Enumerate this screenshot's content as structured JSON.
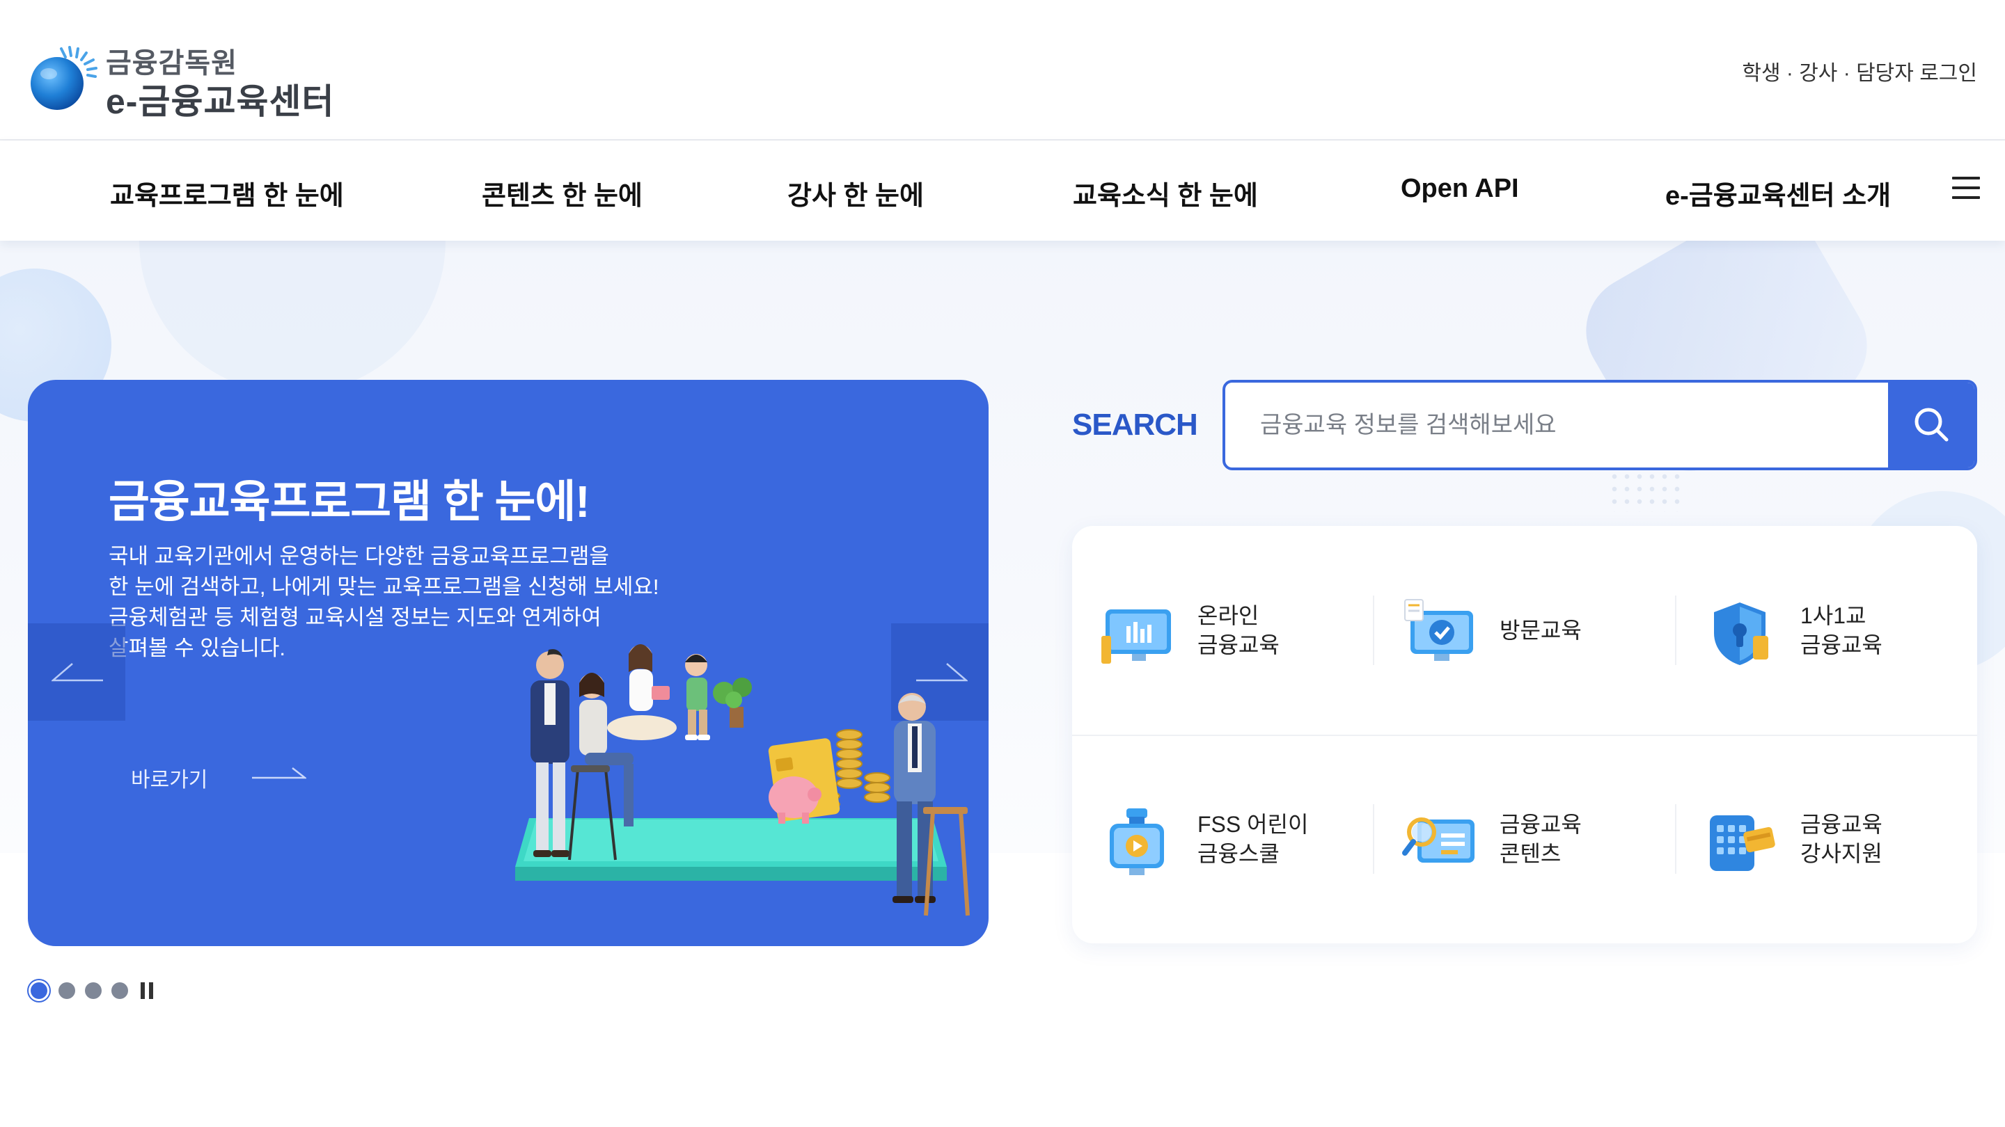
{
  "header": {
    "logo_line1": "금융감독원",
    "logo_line2": "e-금융교육센터",
    "login_link": "학생 · 강사 · 담당자 로그인"
  },
  "nav": {
    "items": [
      "교육프로그램 한 눈에",
      "콘텐츠 한 눈에",
      "강사 한 눈에",
      "교육소식 한 눈에",
      "Open API",
      "e-금융교육센터 소개"
    ],
    "menu_icon": "hamburger-menu-icon"
  },
  "banner": {
    "title": "금융교육프로그램 한 눈에!",
    "description": [
      "국내 교육기관에서 운영하는 다양한 금융교육프로그램을",
      "한 눈에 검색하고, 나에게 맞는 교육프로그램을 신청해 보세요!",
      "금융체험관 등 체험형 교육시설 정보는 지도와 연계하여",
      "살펴볼 수 있습니다."
    ],
    "link_label": "바로가기",
    "prev_icon": "arrow-left-icon",
    "next_icon": "arrow-right-icon",
    "background_color": "#3a68de",
    "slide_count": 4,
    "active_slide": 1
  },
  "search": {
    "label": "SEARCH",
    "placeholder": "금융교육 정보를 검색해보세요",
    "value": "",
    "button_icon": "search-icon",
    "accent_color": "#3a68de"
  },
  "quick_menu": {
    "items": [
      {
        "line1": "온라인",
        "line2": "금융교육",
        "icon": "monitor-chart-icon"
      },
      {
        "line1": "방문교육",
        "line2": "",
        "icon": "monitor-check-icon"
      },
      {
        "line1": "1사1교",
        "line2": "금융교육",
        "icon": "shield-lock-icon"
      },
      {
        "line1": "FSS 어린이",
        "line2": "금융스쿨",
        "icon": "kids-video-icon"
      },
      {
        "line1": "금융교육",
        "line2": "콘텐츠",
        "icon": "content-search-icon"
      },
      {
        "line1": "금융교육",
        "line2": "강사지원",
        "icon": "calculator-card-icon"
      }
    ]
  }
}
